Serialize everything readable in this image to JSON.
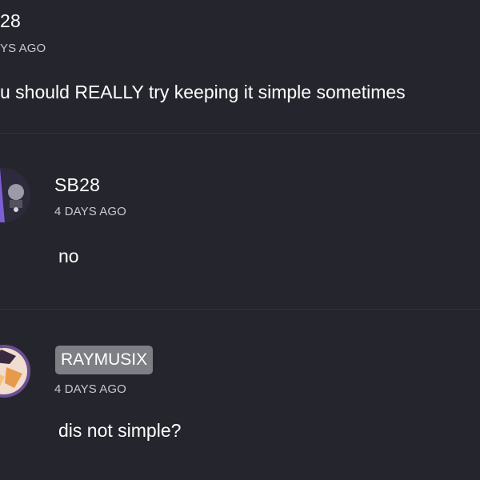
{
  "comments": [
    {
      "username": "28",
      "timestamp": "YS AGO",
      "text": "u should REALLY try keeping it simple sometimes"
    },
    {
      "username": "SB28",
      "timestamp": "4 DAYS AGO",
      "text": "no",
      "avatar_icon": "dark-purple-character-avatar"
    },
    {
      "username": "RAYMUSIX",
      "timestamp": "4 DAYS AGO",
      "text": "dis not simple?",
      "avatar_icon": "anime-character-avatar"
    }
  ],
  "colors": {
    "background": "#25262d",
    "divider": "#34353d",
    "text": "#ffffff",
    "timestamp": "#c9c9cf",
    "badge": "#7e7f84"
  }
}
